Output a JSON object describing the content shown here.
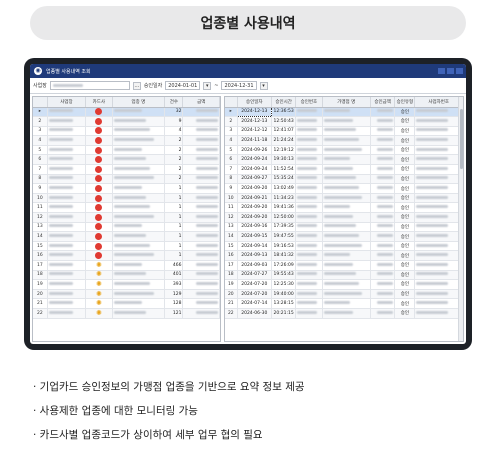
{
  "page": {
    "title": "업종별 사용내역"
  },
  "window": {
    "title": "업종별 사용내역 조회",
    "filter": {
      "company_label": "사업장",
      "date_label": "승인일자",
      "date_from": "2024-01-01",
      "range_sep": "~",
      "date_to": "2024-12-31"
    }
  },
  "left_table": {
    "columns": [
      "",
      "사업장",
      "카드사",
      "업종 명",
      "건수",
      "금액"
    ],
    "rows": [
      {
        "arrow": "▸",
        "no": "1",
        "count": "32",
        "icon": "red"
      },
      {
        "arrow": "",
        "no": "2",
        "count": "9",
        "icon": "red"
      },
      {
        "arrow": "",
        "no": "3",
        "count": "4",
        "icon": "red"
      },
      {
        "arrow": "",
        "no": "4",
        "count": "2",
        "icon": "red"
      },
      {
        "arrow": "",
        "no": "5",
        "count": "2",
        "icon": "red"
      },
      {
        "arrow": "",
        "no": "6",
        "count": "2",
        "icon": "red"
      },
      {
        "arrow": "",
        "no": "7",
        "count": "2",
        "icon": "red"
      },
      {
        "arrow": "",
        "no": "8",
        "count": "2",
        "icon": "red"
      },
      {
        "arrow": "",
        "no": "9",
        "count": "1",
        "icon": "red"
      },
      {
        "arrow": "",
        "no": "10",
        "count": "1",
        "icon": "red"
      },
      {
        "arrow": "",
        "no": "11",
        "count": "1",
        "icon": "red"
      },
      {
        "arrow": "",
        "no": "12",
        "count": "1",
        "icon": "red"
      },
      {
        "arrow": "",
        "no": "13",
        "count": "1",
        "icon": "red"
      },
      {
        "arrow": "",
        "no": "14",
        "count": "1",
        "icon": "red"
      },
      {
        "arrow": "",
        "no": "15",
        "count": "1",
        "icon": "red"
      },
      {
        "arrow": "",
        "no": "16",
        "count": "1",
        "icon": "red"
      },
      {
        "arrow": "",
        "no": "17",
        "count": "466",
        "icon": "sun"
      },
      {
        "arrow": "",
        "no": "18",
        "count": "401",
        "icon": "sun"
      },
      {
        "arrow": "",
        "no": "19",
        "count": "393",
        "icon": "sun"
      },
      {
        "arrow": "",
        "no": "20",
        "count": "129",
        "icon": "sun"
      },
      {
        "arrow": "",
        "no": "21",
        "count": "128",
        "icon": "sun"
      },
      {
        "arrow": "",
        "no": "22",
        "count": "121",
        "icon": "sun"
      }
    ]
  },
  "right_table": {
    "columns": [
      "",
      "승인일자",
      "승인시간",
      "승인번호",
      "가맹점 명",
      "승인금액",
      "승인유형",
      "사업자번호"
    ],
    "rows": [
      {
        "arrow": "▸",
        "no": "1",
        "date": "2024-12-13",
        "time": "12:36:53",
        "type": "승인"
      },
      {
        "arrow": "",
        "no": "2",
        "date": "2024-12-13",
        "time": "12:50:43",
        "type": "승인"
      },
      {
        "arrow": "",
        "no": "3",
        "date": "2024-12-12",
        "time": "12:41:07",
        "type": "승인"
      },
      {
        "arrow": "",
        "no": "4",
        "date": "2024-11-18",
        "time": "21:24:24",
        "type": "승인"
      },
      {
        "arrow": "",
        "no": "5",
        "date": "2024-09-26",
        "time": "12:19:12",
        "type": "승인"
      },
      {
        "arrow": "",
        "no": "6",
        "date": "2024-09-24",
        "time": "19:30:13",
        "type": "승인"
      },
      {
        "arrow": "",
        "no": "7",
        "date": "2024-09-24",
        "time": "11:52:54",
        "type": "승인"
      },
      {
        "arrow": "",
        "no": "8",
        "date": "2024-09-27",
        "time": "15:35:24",
        "type": "승인"
      },
      {
        "arrow": "",
        "no": "9",
        "date": "2024-09-20",
        "time": "13:02:49",
        "type": "승인"
      },
      {
        "arrow": "",
        "no": "10",
        "date": "2024-09-21",
        "time": "11:34:23",
        "type": "승인"
      },
      {
        "arrow": "",
        "no": "11",
        "date": "2024-09-20",
        "time": "19:41:36",
        "type": "승인"
      },
      {
        "arrow": "",
        "no": "12",
        "date": "2024-09-20",
        "time": "12:50:00",
        "type": "승인"
      },
      {
        "arrow": "",
        "no": "13",
        "date": "2024-09-16",
        "time": "17:39:35",
        "type": "승인"
      },
      {
        "arrow": "",
        "no": "14",
        "date": "2024-09-15",
        "time": "19:47:55",
        "type": "승인"
      },
      {
        "arrow": "",
        "no": "15",
        "date": "2024-09-14",
        "time": "19:16:53",
        "type": "승인"
      },
      {
        "arrow": "",
        "no": "16",
        "date": "2024-09-13",
        "time": "18:41:32",
        "type": "승인"
      },
      {
        "arrow": "",
        "no": "17",
        "date": "2024-09-03",
        "time": "17:26:09",
        "type": "승인"
      },
      {
        "arrow": "",
        "no": "18",
        "date": "2024-07-27",
        "time": "19:55:43",
        "type": "승인"
      },
      {
        "arrow": "",
        "no": "19",
        "date": "2024-07-20",
        "time": "12:25:30",
        "type": "승인"
      },
      {
        "arrow": "",
        "no": "20",
        "date": "2024-07-20",
        "time": "19:40:00",
        "type": "승인"
      },
      {
        "arrow": "",
        "no": "21",
        "date": "2024-07-14",
        "time": "13:28:15",
        "type": "승인"
      },
      {
        "arrow": "",
        "no": "22",
        "date": "2024-06-30",
        "time": "20:21:15",
        "type": "승인"
      }
    ]
  },
  "bullets": [
    "· 기업카드 승인정보의 가맹점 업종을 기반으로 요약 정보 제공",
    "· 사용제한 업종에 대한 모니터링 가능",
    "· 카드사별 업종코드가 상이하여 세부 업무 협의 필요"
  ]
}
